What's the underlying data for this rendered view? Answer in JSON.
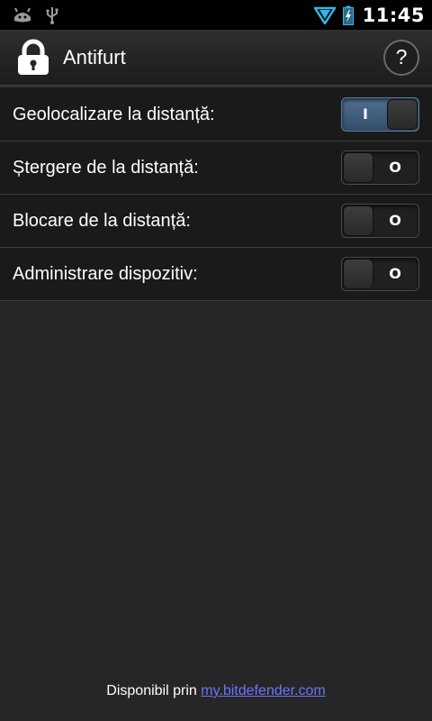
{
  "status_bar": {
    "time": "11:45",
    "left_icons": [
      "android-debug-icon",
      "usb-icon"
    ],
    "right_icons": [
      "wifi-signal-icon",
      "battery-charging-icon"
    ]
  },
  "action_bar": {
    "title": "Antifurt",
    "help_label": "?"
  },
  "settings": [
    {
      "label": "Geolocalizare la distanță:",
      "state": "I",
      "on": true
    },
    {
      "label": "Ștergere de la distanță:",
      "state": "O",
      "on": false
    },
    {
      "label": "Blocare de la distanță:",
      "state": "O",
      "on": false
    },
    {
      "label": "Administrare dispozitiv:",
      "state": "O",
      "on": false
    }
  ],
  "footer": {
    "prefix": "Disponibil prin",
    "link_text": "my.bitdefender.com"
  },
  "colors": {
    "toggle_on": "#4f6f93",
    "link": "#6c73ff",
    "wifi": "#33b5e5"
  }
}
